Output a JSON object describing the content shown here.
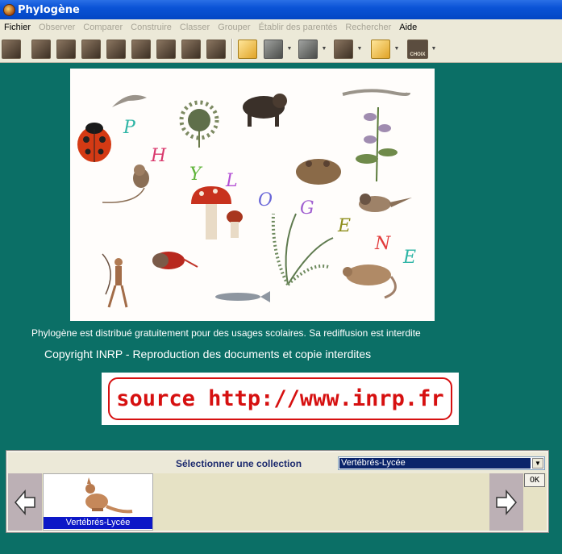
{
  "window": {
    "title": "Phylogène"
  },
  "menu": [
    {
      "label": "Fichier",
      "enabled": true
    },
    {
      "label": "Observer",
      "enabled": false
    },
    {
      "label": "Comparer",
      "enabled": false
    },
    {
      "label": "Construire",
      "enabled": false
    },
    {
      "label": "Classer",
      "enabled": false
    },
    {
      "label": "Grouper",
      "enabled": false
    },
    {
      "label": "Établir des parentés",
      "enabled": false
    },
    {
      "label": "Rechercher",
      "enabled": false
    },
    {
      "label": "Aide",
      "enabled": true
    }
  ],
  "toolbar": {
    "choix_label": "CHOIX"
  },
  "splash": {
    "letters": [
      "P",
      "H",
      "Y",
      "L",
      "O",
      "G",
      "E",
      "N",
      "E"
    ],
    "letter_colors": [
      "#2fb5a6",
      "#d9386c",
      "#5fb43a",
      "#b34fd4",
      "#6a67d8",
      "#a05fd0",
      "#8e8e1c",
      "#e23a3a",
      "#2fb5a6"
    ]
  },
  "notice": "Phylogène est  distribué gratuitement pour des  usages scolaires. Sa rediffusion est interdite",
  "copyright": "Copyright INRP - Reproduction des documents et copie interdites",
  "source": "source http://www.inrp.fr",
  "collection": {
    "label": "Sélectionner une collection",
    "selected": "Vertébrés-Lycée",
    "thumbnail_label": "Vertébrés-Lycée",
    "ok_label": "OK"
  },
  "colors": {
    "background": "#0b6f66",
    "accent": "#0c17c7",
    "source_red": "#d61010"
  }
}
